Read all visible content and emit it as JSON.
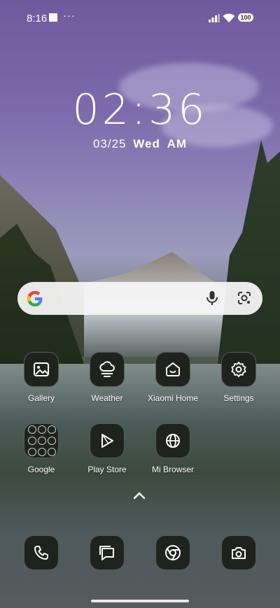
{
  "status": {
    "time": "8:16",
    "more": "···",
    "battery": "100"
  },
  "lockscreen": {
    "clock": "02:36",
    "date": "03/25",
    "weekday": "Wed",
    "ampm": "AM"
  },
  "search": {
    "logo": "google-g-icon",
    "mic": "mic-icon",
    "lens": "lens-icon"
  },
  "apps_row1": [
    {
      "label": "Gallery",
      "icon": "gallery-icon"
    },
    {
      "label": "Weather",
      "icon": "weather-icon"
    },
    {
      "label": "Xiaomi Home",
      "icon": "home-icon"
    },
    {
      "label": "Settings",
      "icon": "gear-icon"
    }
  ],
  "apps_row2": [
    {
      "label": "Google",
      "icon": "folder-icon"
    },
    {
      "label": "Play Store",
      "icon": "play-icon"
    },
    {
      "label": "Mi Browser",
      "icon": "globe-icon"
    }
  ],
  "dock": [
    {
      "icon": "phone-icon"
    },
    {
      "icon": "messages-icon"
    },
    {
      "icon": "chrome-icon"
    },
    {
      "icon": "camera-icon"
    }
  ]
}
